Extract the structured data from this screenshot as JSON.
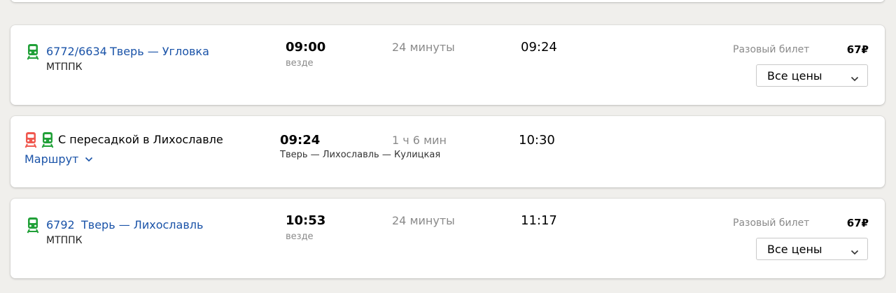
{
  "colors": {
    "link": "#1a53a8",
    "train_green": "#21a038",
    "train_red": "#f0584f"
  },
  "trips": [
    {
      "number": "6772/6634",
      "route": "Тверь — Угловка",
      "carrier": "МТППК",
      "departure": "09:00",
      "departure_note": "везде",
      "duration": "24 минуты",
      "arrival": "09:24",
      "ticket_type": "Разовый билет",
      "price": "67₽",
      "prices_button": "Все цены"
    },
    {
      "title": "С пересадкой в Лихославле",
      "route_link": "Маршрут",
      "departure": "09:24",
      "route_stations": "Тверь — Лихославль — Кулицкая",
      "duration": "1 ч 6 мин",
      "arrival": "10:30"
    },
    {
      "number": "6792",
      "route": "Тверь — Лихославль",
      "carrier": "МТППК",
      "departure": "10:53",
      "departure_note": "везде",
      "duration": "24 минуты",
      "arrival": "11:17",
      "ticket_type": "Разовый билет",
      "price": "67₽",
      "prices_button": "Все цены"
    }
  ],
  "icons": {
    "train": "suburban-train-icon",
    "chevron": "chevron-down-icon"
  }
}
